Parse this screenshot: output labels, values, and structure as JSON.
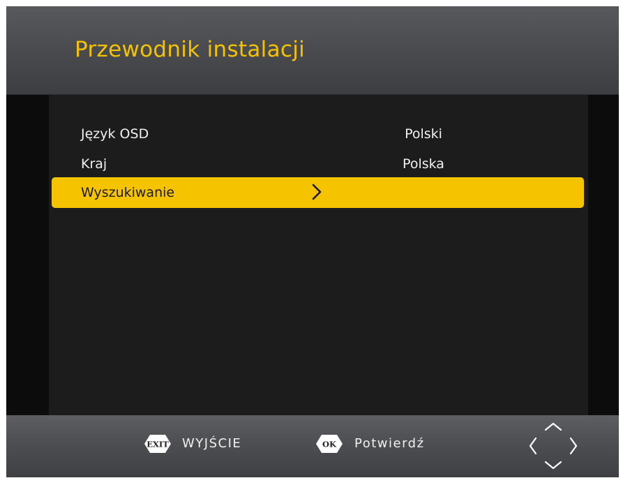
{
  "header": {
    "title": "Przewodnik instalacji"
  },
  "menu": {
    "items": [
      {
        "label": "Język OSD",
        "value": "Polski"
      },
      {
        "label": "Kraj",
        "value": "Polska"
      },
      {
        "label": "Wyszukiwanie",
        "value": ""
      }
    ],
    "selected_index": 2
  },
  "footer": {
    "exit_key": "EXIT",
    "exit_label": "WYJŚCIE",
    "ok_key": "OK",
    "ok_label": "Potwierdź"
  },
  "icons": {
    "submenu": "chevron-right-icon",
    "navigation": "navigation-arrows-icon"
  },
  "colors": {
    "accent": "#f6c300",
    "title": "#f5c200",
    "background": "#0c0c0c",
    "panel": "#1c1c1c",
    "bar": "#4b4d50",
    "text": "#f0f0f0"
  }
}
